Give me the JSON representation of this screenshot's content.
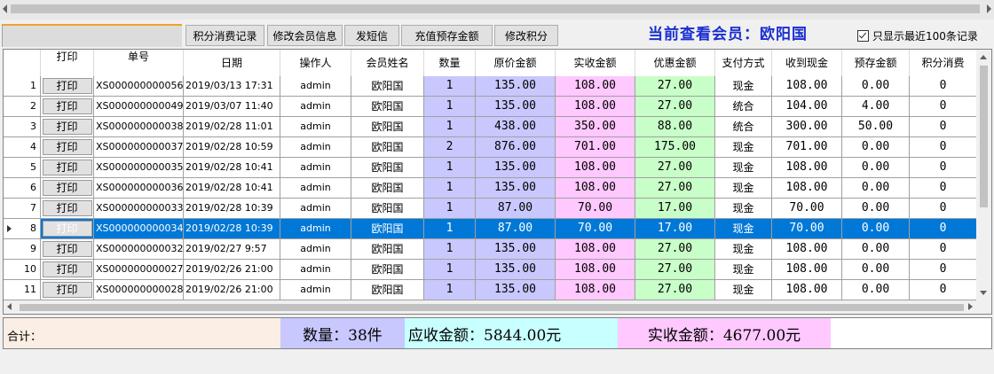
{
  "toolbar": {
    "buttons": [
      "积分消费记录",
      "修改会员信息",
      "发短信",
      "充值预存金额",
      "修改积分"
    ],
    "member_title": "当前查看会员：欧阳国",
    "only_recent_checkbox": "只显示最近100条记录",
    "only_recent_checked": true
  },
  "grid": {
    "headers": [
      "打印",
      "单号",
      "日期",
      "操作人",
      "会员姓名",
      "数量",
      "原价金额",
      "实收金额",
      "优惠金额",
      "支付方式",
      "收到现金",
      "预存金额",
      "积分消费"
    ],
    "print_label": "打印",
    "selected_row": 7,
    "rows": [
      {
        "n": "1",
        "order": "XS000000000056",
        "date": "2019/03/13 17:31",
        "op": "admin",
        "name": "欧阳国",
        "qty": "1",
        "orig": "135.00",
        "act": "108.00",
        "disc": "27.00",
        "pay": "现金",
        "cash": "108.00",
        "prepay": "0.00",
        "points": "0"
      },
      {
        "n": "2",
        "order": "XS000000000049",
        "date": "2019/03/07 11:40",
        "op": "admin",
        "name": "欧阳国",
        "qty": "1",
        "orig": "135.00",
        "act": "108.00",
        "disc": "27.00",
        "pay": "统合",
        "cash": "104.00",
        "prepay": "4.00",
        "points": "0"
      },
      {
        "n": "3",
        "order": "XS000000000038",
        "date": "2019/02/28 11:01",
        "op": "admin",
        "name": "欧阳国",
        "qty": "1",
        "orig": "438.00",
        "act": "350.00",
        "disc": "88.00",
        "pay": "统合",
        "cash": "300.00",
        "prepay": "50.00",
        "points": "0"
      },
      {
        "n": "4",
        "order": "XS000000000037",
        "date": "2019/02/28 10:59",
        "op": "admin",
        "name": "欧阳国",
        "qty": "2",
        "orig": "876.00",
        "act": "701.00",
        "disc": "175.00",
        "pay": "现金",
        "cash": "701.00",
        "prepay": "0.00",
        "points": "0"
      },
      {
        "n": "5",
        "order": "XS000000000035",
        "date": "2019/02/28 10:41",
        "op": "admin",
        "name": "欧阳国",
        "qty": "1",
        "orig": "135.00",
        "act": "108.00",
        "disc": "27.00",
        "pay": "现金",
        "cash": "108.00",
        "prepay": "0.00",
        "points": "0"
      },
      {
        "n": "6",
        "order": "XS000000000036",
        "date": "2019/02/28 10:41",
        "op": "admin",
        "name": "欧阳国",
        "qty": "1",
        "orig": "135.00",
        "act": "108.00",
        "disc": "27.00",
        "pay": "现金",
        "cash": "108.00",
        "prepay": "0.00",
        "points": "0"
      },
      {
        "n": "7",
        "order": "XS000000000033",
        "date": "2019/02/28 10:39",
        "op": "admin",
        "name": "欧阳国",
        "qty": "1",
        "orig": "87.00",
        "act": "70.00",
        "disc": "17.00",
        "pay": "现金",
        "cash": "70.00",
        "prepay": "0.00",
        "points": "0"
      },
      {
        "n": "8",
        "order": "XS000000000034",
        "date": "2019/02/28 10:39",
        "op": "admin",
        "name": "欧阳国",
        "qty": "1",
        "orig": "87.00",
        "act": "70.00",
        "disc": "17.00",
        "pay": "现金",
        "cash": "70.00",
        "prepay": "0.00",
        "points": "0"
      },
      {
        "n": "9",
        "order": "XS000000000032",
        "date": "2019/02/27 9:57",
        "op": "admin",
        "name": "欧阳国",
        "qty": "1",
        "orig": "135.00",
        "act": "108.00",
        "disc": "27.00",
        "pay": "现金",
        "cash": "108.00",
        "prepay": "0.00",
        "points": "0"
      },
      {
        "n": "10",
        "order": "XS000000000027",
        "date": "2019/02/26 21:00",
        "op": "admin",
        "name": "欧阳国",
        "qty": "1",
        "orig": "135.00",
        "act": "108.00",
        "disc": "27.00",
        "pay": "现金",
        "cash": "108.00",
        "prepay": "0.00",
        "points": "0"
      },
      {
        "n": "11",
        "order": "XS000000000028",
        "date": "2019/02/26 21:00",
        "op": "admin",
        "name": "欧阳国",
        "qty": "1",
        "orig": "135.00",
        "act": "108.00",
        "disc": "27.00",
        "pay": "现金",
        "cash": "108.00",
        "prepay": "0.00",
        "points": "0"
      }
    ]
  },
  "summary": {
    "total_label": "合计：",
    "qty": "数量：38件",
    "receivable": "应收金额：5844.00元",
    "actual": "实收金额：4677.00元"
  },
  "colors": {
    "qty_bg": "#c8c8ff",
    "orig_bg": "#c8c8ff",
    "actual_bg": "#ffc8ff",
    "discount_bg": "#c8ffc8",
    "selected_row_bg": "#0078d7",
    "title_color": "#1a2fd0"
  }
}
